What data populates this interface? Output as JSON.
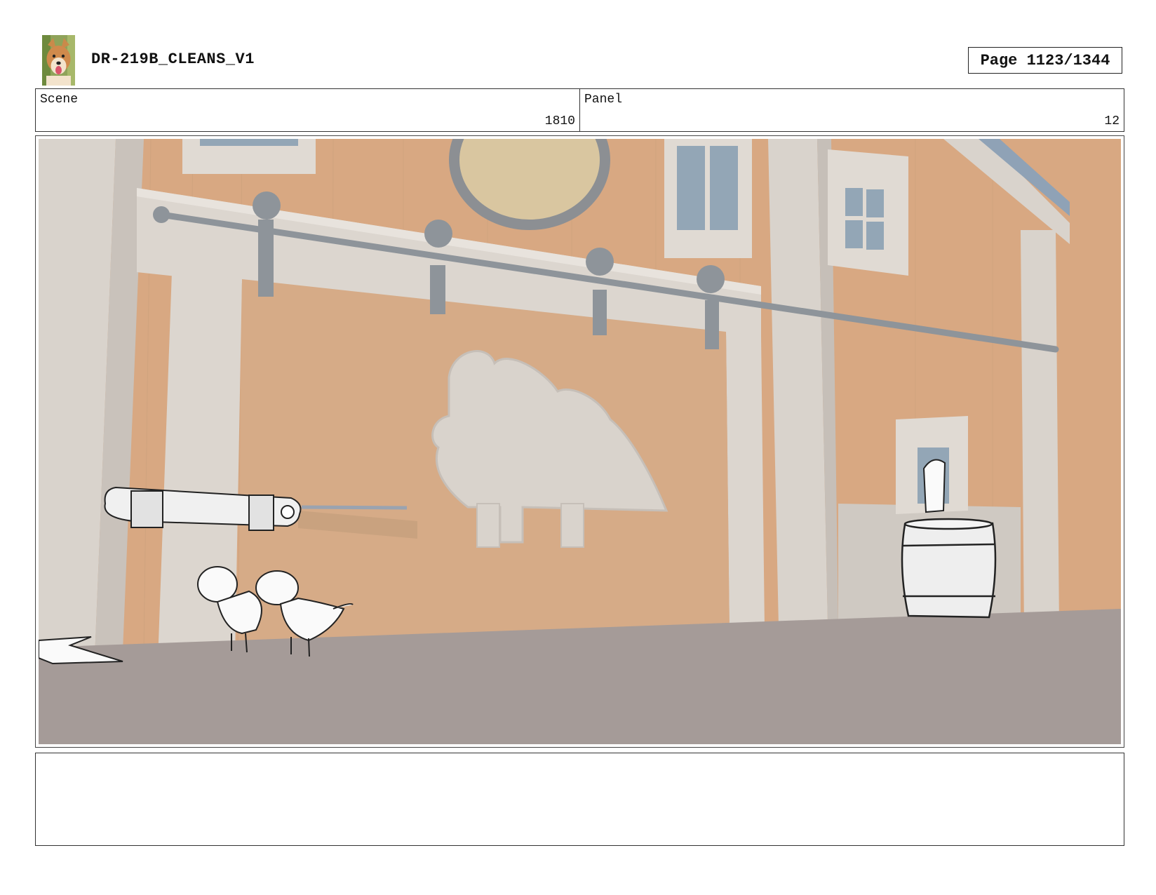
{
  "header": {
    "title": "DR-219B_CLEANS_V1",
    "page": "Page 1123/1344",
    "logo_icon": "dog-photo-icon"
  },
  "meta": {
    "scene_label": "Scene",
    "scene_value": "1810",
    "panel_label": "Panel",
    "panel_value": "12"
  },
  "frame": {
    "description_icon": "storyboard-panel-barn-dinosaurs",
    "colors": {
      "wall": "#d8a882",
      "trim": "#d9d3cc",
      "rail": "#8e949a",
      "ground": "#a59b98",
      "window_glass": "#93a6b6"
    }
  },
  "notes": {
    "text": ""
  }
}
